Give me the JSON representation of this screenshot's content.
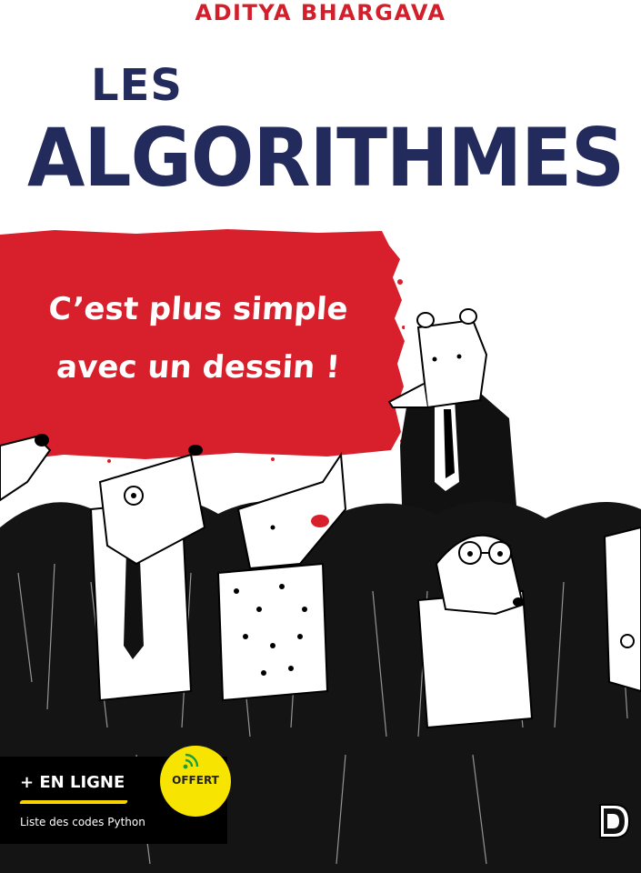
{
  "cover": {
    "author": "ADITYA BHARGAVA",
    "title_line1": "LES",
    "title_line2": "ALGORITHMES",
    "tagline_line1": "C’est plus simple",
    "tagline_line2": "avec un dessin !",
    "online_label": "+ EN LIGNE",
    "online_description": "Liste des codes Python",
    "badge_label": "OFFERT",
    "icons": [
      "wifi-icon",
      "publisher-logo-icon"
    ]
  },
  "colors": {
    "title": "#232b5c",
    "author": "#d21f2b",
    "band": "#d8202c",
    "badge": "#f7e400",
    "accent_line": "#f5d200"
  }
}
